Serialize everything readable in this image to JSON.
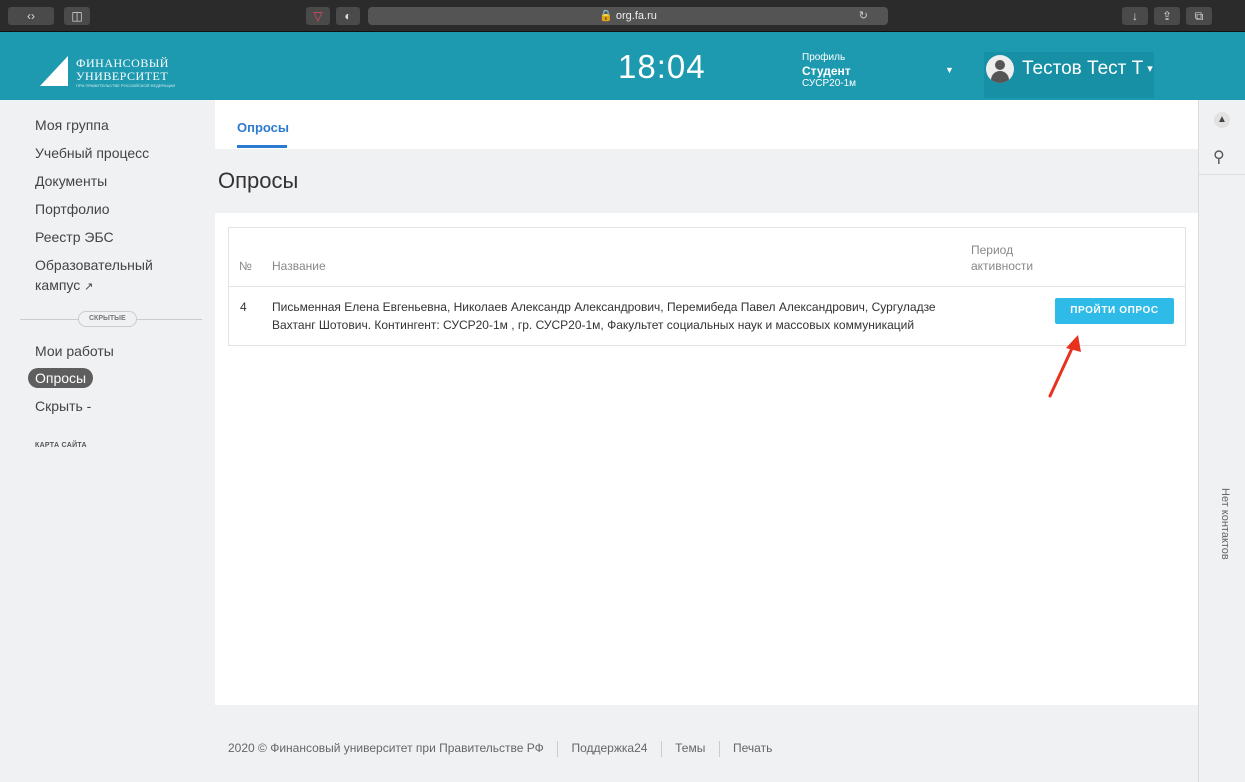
{
  "browser": {
    "url": "org.fa.ru"
  },
  "header": {
    "logo_line1": "ФИНАНСОВЫЙ",
    "logo_line2": "УНИВЕРСИТЕТ",
    "logo_line3": "ПРИ ПРАВИТЕЛЬСТВЕ РОССИЙСКОЙ ФЕДЕРАЦИИ",
    "time": "18:04",
    "profile_label": "Профиль",
    "profile_role": "Студент",
    "profile_group": "СУСР20-1м",
    "user_name": "Тестов Тест Т"
  },
  "sidebar": {
    "items": [
      {
        "label": "Моя группа"
      },
      {
        "label": "Учебный процесс"
      },
      {
        "label": "Документы"
      },
      {
        "label": "Портфолио"
      },
      {
        "label": "Реестр ЭБС"
      },
      {
        "label": "Образовательный"
      },
      {
        "label": "кампус"
      }
    ],
    "hidden_label": "СКРЫТЫЕ",
    "hidden_items": [
      {
        "label": "Мои работы"
      },
      {
        "label": "Опросы"
      },
      {
        "label": "Скрыть -"
      }
    ],
    "sitemap": "КАРТА САЙТА"
  },
  "main": {
    "tab": "Опросы",
    "title": "Опросы",
    "table": {
      "headers": {
        "num": "№",
        "name": "Название",
        "period_line1": "Период",
        "period_line2": "активности"
      },
      "rows": [
        {
          "num": "4",
          "name_line1": "Письменная Елена Евгеньевна, Николаев Александр Александрович, Перемибеда Павел Александрович, Сургуладзе",
          "name_line2": "Вахтанг Шотович. Контингент: СУСР20-1м , гр. СУСР20-1м, Факультет социальных наук и массовых коммуникаций",
          "action": "ПРОЙТИ ОПРОС"
        }
      ]
    }
  },
  "rail": {
    "contacts": "Нет контактов"
  },
  "footer": {
    "copyright": "2020 © Финансовый университет при Правительстве РФ",
    "support": "Поддержка24",
    "themes": "Темы",
    "print": "Печать"
  },
  "colors": {
    "header_bg": "#1e9ab0",
    "accent_blue": "#2c7bd0",
    "button_bg": "#2fbbe8",
    "arrow_red": "#e8321e"
  }
}
